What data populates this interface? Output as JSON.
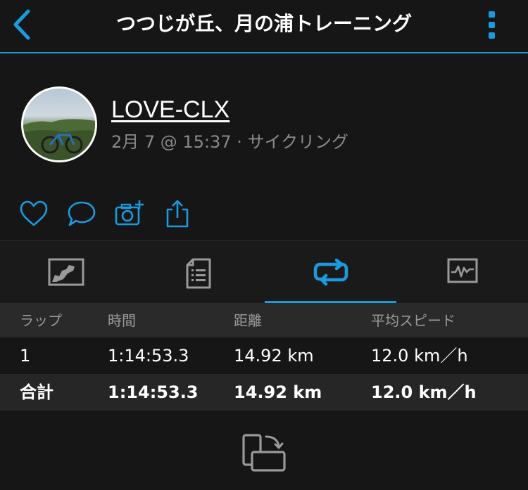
{
  "header": {
    "title": "つつじが丘、月の浦トレーニング",
    "back_icon": "chevron-left-icon",
    "menu_icon": "more-vertical-icon",
    "accent_color": "#1a9be0"
  },
  "profile": {
    "name": "LOVE-CLX",
    "meta": "2月 7 @ 15:37 · サイクリング"
  },
  "actions": [
    "heart-icon",
    "comment-icon",
    "add-photo-icon",
    "share-icon"
  ],
  "tabs": [
    {
      "icon": "map-icon",
      "active": false
    },
    {
      "icon": "details-list-icon",
      "active": false
    },
    {
      "icon": "laps-icon",
      "active": true
    },
    {
      "icon": "chart-icon",
      "active": false
    }
  ],
  "laps_table": {
    "headers": [
      "ラップ",
      "時間",
      "距離",
      "平均スピード"
    ],
    "rows": [
      [
        "1",
        "1:14:53.3",
        "14.92 km",
        "12.0 km／h"
      ]
    ],
    "total": [
      "合計",
      "1:14:53.3",
      "14.92 km",
      "12.0 km／h"
    ]
  },
  "bottom": {
    "icon": "rotate-screen-icon"
  }
}
